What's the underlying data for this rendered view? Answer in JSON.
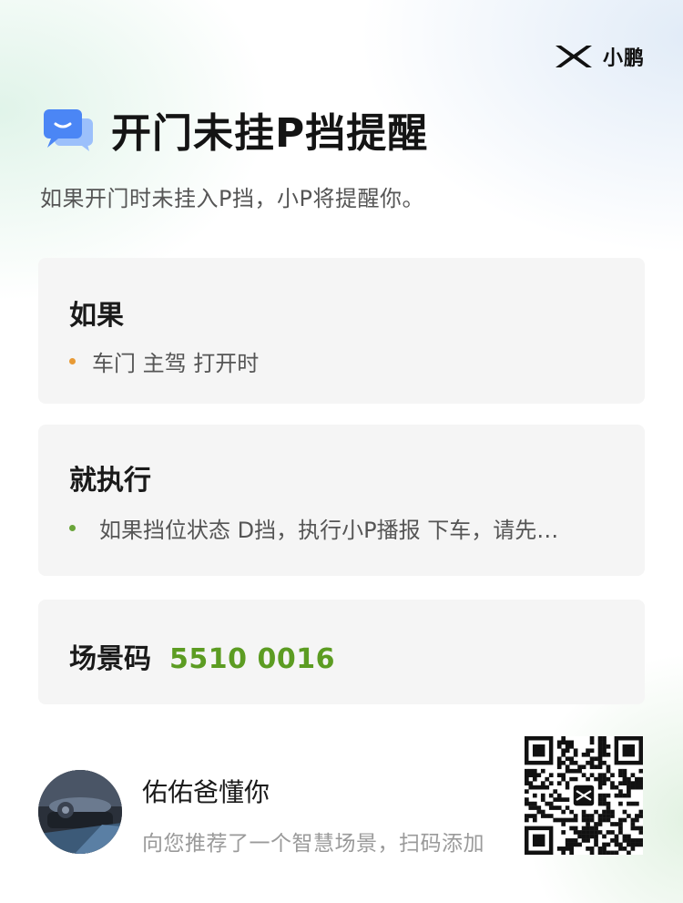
{
  "brand": {
    "name": "小鹏",
    "logo_icon": "xpeng-x-logo-icon"
  },
  "header": {
    "icon": "chat-bubble-icon",
    "title": "开门未挂P挡提醒",
    "subtitle": "如果开门时未挂入P挡，小P将提醒你。"
  },
  "condition": {
    "heading": "如果",
    "items": [
      {
        "text": "车门 主驾 打开时"
      }
    ]
  },
  "action": {
    "heading": "就执行",
    "items": [
      {
        "text": "如果挡位状态 D挡，执行小P播报 下车，请先…"
      }
    ]
  },
  "scene": {
    "label": "场景码",
    "code": "5510 0016"
  },
  "share": {
    "author": "佑佑爸懂你",
    "message": "向您推荐了一个智慧场景，扫码添加",
    "qr_icon": "qr-code-icon"
  },
  "colors": {
    "accent_green": "#5c9c22",
    "bullet_orange": "#e89a35",
    "bullet_green": "#6aa53a",
    "card_bg": "#f5f5f5",
    "icon_blue": "#4b86f5"
  }
}
